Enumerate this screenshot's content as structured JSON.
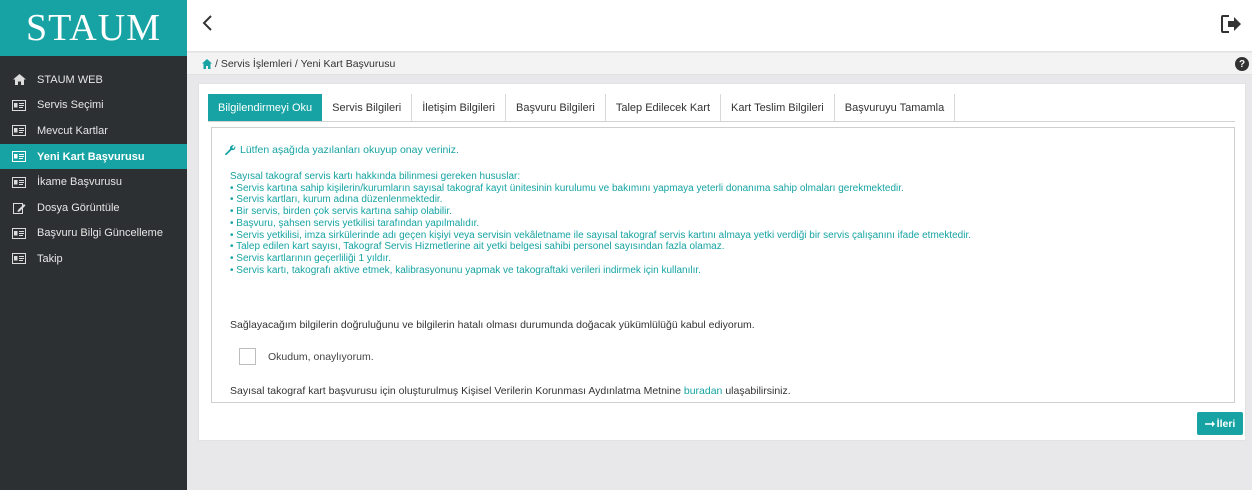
{
  "app": {
    "logo": "STAUM"
  },
  "sidebar": {
    "items": [
      {
        "label": "STAUM WEB",
        "icon": "home-icon",
        "active": false
      },
      {
        "label": "Servis Seçimi",
        "icon": "id-card-icon",
        "active": false
      },
      {
        "label": "Mevcut Kartlar",
        "icon": "id-card-icon",
        "active": false
      },
      {
        "label": "Yeni Kart Başvurusu",
        "icon": "id-card-icon",
        "active": true
      },
      {
        "label": "İkame Başvurusu",
        "icon": "id-card-icon",
        "active": false
      },
      {
        "label": "Dosya Görüntüle",
        "icon": "edit-icon",
        "active": false
      },
      {
        "label": "Başvuru Bilgi Güncelleme",
        "icon": "id-card-icon",
        "active": false
      },
      {
        "label": "Takip",
        "icon": "id-card-icon",
        "active": false
      }
    ]
  },
  "breadcrumb": {
    "text": "/ Servis İşlemleri / Yeni Kart Başvurusu"
  },
  "help": {
    "label": "?"
  },
  "tabs": [
    {
      "label": "Bilgilendirmeyi Oku",
      "active": true
    },
    {
      "label": "Servis Bilgileri",
      "active": false
    },
    {
      "label": "İletişim Bilgileri",
      "active": false
    },
    {
      "label": "Başvuru Bilgileri",
      "active": false
    },
    {
      "label": "Talep Edilecek Kart",
      "active": false
    },
    {
      "label": "Kart Teslim Bilgileri",
      "active": false
    },
    {
      "label": "Başvuruyu Tamamla",
      "active": false
    }
  ],
  "notice": {
    "text": "Lütfen aşağıda yazılanları okuyup onay veriniz."
  },
  "info": {
    "heading": "Sayısal takograf servis kartı hakkında bilinmesi gereken hususlar:",
    "items": [
      "• Servis kartına sahip kişilerin/kurumların sayısal takograf kayıt ünitesinin kurulumu ve bakımını yapmaya yeterli donanıma sahip olmaları gerekmektedir.",
      "• Servis kartları, kurum adına düzenlenmektedir.",
      "• Bir servis, birden çok servis kartına sahip olabilir.",
      "• Başvuru, şahsen servis yetkilisi tarafından yapılmalıdır.",
      "• Servis yetkilisi, imza sirkülerinde adı geçen kişiyi veya servisin vekâletname ile sayısal takograf servis kartını almaya yetki verdiği bir servis çalışanını ifade etmektedir.",
      "• Talep edilen kart sayısı, Takograf Servis Hizmetlerine ait yetki belgesi sahibi personel sayısından fazla olamaz.",
      "• Servis kartlarının geçerliliği 1 yıldır.",
      "• Servis kartı, takografı aktive etmek, kalibrasyonunu yapmak ve takograftaki verileri indirmek için kullanılır."
    ]
  },
  "declaration": {
    "text": "Sağlayacağım bilgilerin doğruluğunu ve bilgilerin hatalı olması durumunda doğacak yükümlülüğü kabul ediyorum."
  },
  "consent": {
    "label": "Okudum, onaylıyorum.",
    "checked": false
  },
  "kvkk": {
    "before": "Sayısal takograf kart başvurusu için oluşturulmuş Kişisel Verilerin Korunması Aydınlatma Metnine ",
    "link": "buradan",
    "after": " ulaşabilirsiniz."
  },
  "next_button": {
    "label": "İleri"
  },
  "colors": {
    "accent": "#17a3a3",
    "sidebar_bg": "#2d3033"
  }
}
